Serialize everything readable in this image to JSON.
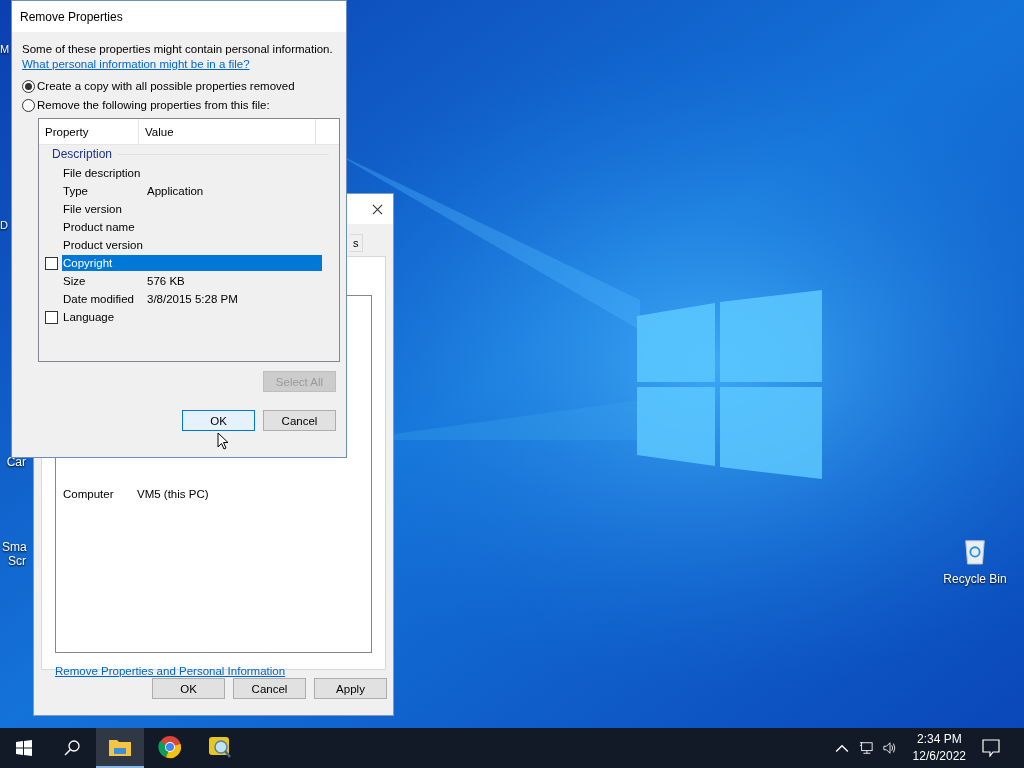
{
  "desktop": {
    "icons": [
      {
        "label": "M"
      },
      {
        "label": "D"
      },
      {
        "label": "Car"
      },
      {
        "label": "Sma Scr"
      }
    ],
    "recycle_bin": {
      "label": "Recycle Bin"
    }
  },
  "properties_window": {
    "tab_label": "s",
    "rows": [
      {
        "property": "Computer",
        "value": "VM5 (this PC)"
      }
    ],
    "link": "Remove Properties and Personal Information",
    "buttons": [
      "OK",
      "Cancel",
      "Apply"
    ]
  },
  "remove_dialog": {
    "title": "Remove Properties",
    "intro": "Some of these properties might contain personal information.",
    "help_link": "What personal information might be in a file?",
    "options": [
      {
        "label": "Create a copy with all possible properties removed",
        "selected": true
      },
      {
        "label": "Remove the following properties from this file:",
        "selected": false
      }
    ],
    "table": {
      "columns": [
        "Property",
        "Value"
      ],
      "groups": [
        {
          "name": "Description",
          "rows": [
            {
              "kind": "plain",
              "property": "File description",
              "selected": false
            },
            {
              "kind": "plain",
              "property": "Type",
              "value": "Application",
              "selected": false
            },
            {
              "kind": "plain",
              "property": "File version",
              "selected": false
            },
            {
              "kind": "plain",
              "property": "Product name",
              "selected": false
            },
            {
              "kind": "plain",
              "property": "Product version",
              "selected": false
            },
            {
              "kind": "checkbox",
              "property": "Copyright",
              "checked": false,
              "selected": true
            },
            {
              "kind": "plain",
              "property": "Size",
              "value": "576 KB",
              "selected": false
            },
            {
              "kind": "plain",
              "property": "Date modified",
              "value": "3/8/2015 5:28 PM",
              "selected": false
            },
            {
              "kind": "checkbox",
              "property": "Language",
              "checked": false,
              "selected": false
            }
          ]
        }
      ]
    },
    "select_all": {
      "label": "Select All",
      "disabled": true
    },
    "buttons": [
      {
        "label": "OK",
        "focused": true
      },
      {
        "label": "Cancel",
        "focused": false
      }
    ]
  },
  "taskbar": {
    "apps": [
      {
        "kind": "explorer",
        "active": true
      },
      {
        "kind": "chrome",
        "active": false
      },
      {
        "kind": "magnifier",
        "active": false
      }
    ],
    "time": "2:34 PM",
    "date": "12/6/2022"
  }
}
